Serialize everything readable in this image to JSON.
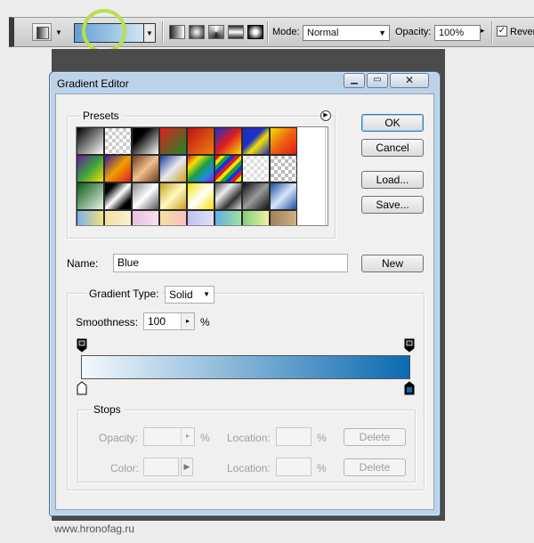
{
  "optionsbar": {
    "mode_label": "Mode:",
    "mode_value": "Normal",
    "opacity_label": "Opacity:",
    "opacity_value": "100%",
    "reverse_label": "Reverse",
    "reverse_checked": true
  },
  "dialog": {
    "title": "Gradient Editor",
    "window_buttons": [
      "minimize",
      "maximize",
      "close"
    ],
    "presets_label": "Presets",
    "buttons": {
      "ok": "OK",
      "cancel": "Cancel",
      "load": "Load...",
      "save": "Save...",
      "new": "New"
    },
    "name_label": "Name:",
    "name_value": "Blue",
    "gradient_type_label": "Gradient Type:",
    "gradient_type_value": "Solid",
    "smoothness_label": "Smoothness:",
    "smoothness_value": "100",
    "smoothness_unit": "%",
    "gradient_colors": [
      "#f4f9fd",
      "#0a6ab0"
    ],
    "stops": {
      "title": "Stops",
      "opacity_label": "Opacity:",
      "opacity_unit": "%",
      "color_label": "Color:",
      "location_label": "Location:",
      "location_unit": "%",
      "delete_label": "Delete"
    }
  },
  "watermark": "www.hronofag.ru"
}
